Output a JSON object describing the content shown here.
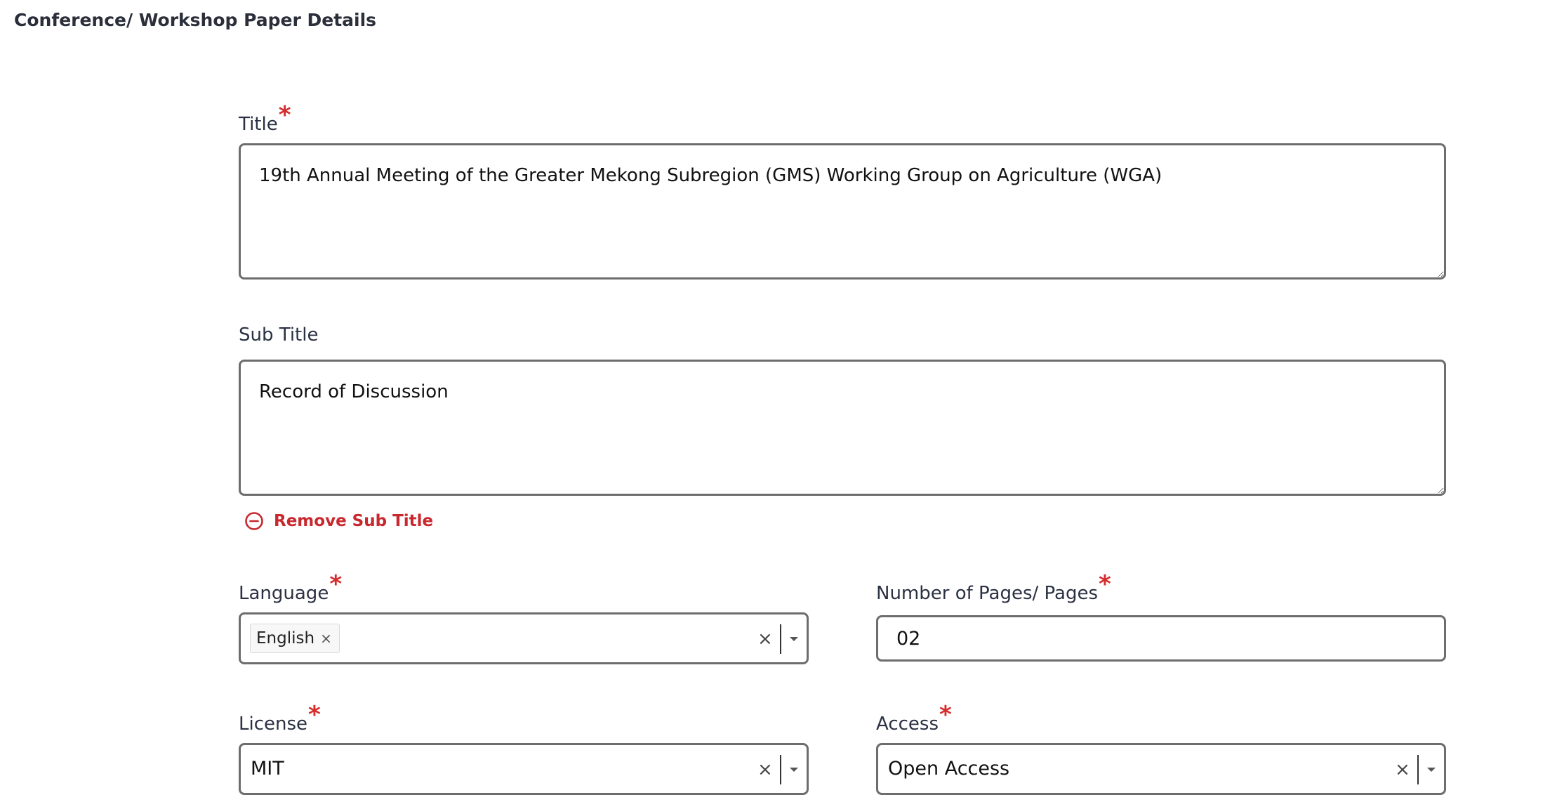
{
  "section_title": "Conference/ Workshop Paper Details",
  "required_marker": "*",
  "colors": {
    "required": "#d62b2b",
    "remove_link": "#c8282e",
    "border": "#6d6d6d",
    "text": "#2a3142"
  },
  "fields": {
    "title": {
      "label": "Title",
      "value": "19th Annual Meeting of the Greater Mekong Subregion (GMS) Working Group on Agriculture (WGA)"
    },
    "sub_title": {
      "label": "Sub Title",
      "value": "Record of Discussion",
      "remove_label": "Remove Sub Title",
      "remove_icon": "minus-circle-icon"
    },
    "language": {
      "label": "Language",
      "selected": [
        "English"
      ],
      "tag_remove": "×",
      "clear": "×"
    },
    "pages": {
      "label": "Number of Pages/ Pages",
      "value": "02"
    },
    "license": {
      "label": "License",
      "selected": "MIT",
      "clear": "×"
    },
    "access": {
      "label": "Access",
      "selected": "Open Access",
      "clear": "×"
    }
  }
}
